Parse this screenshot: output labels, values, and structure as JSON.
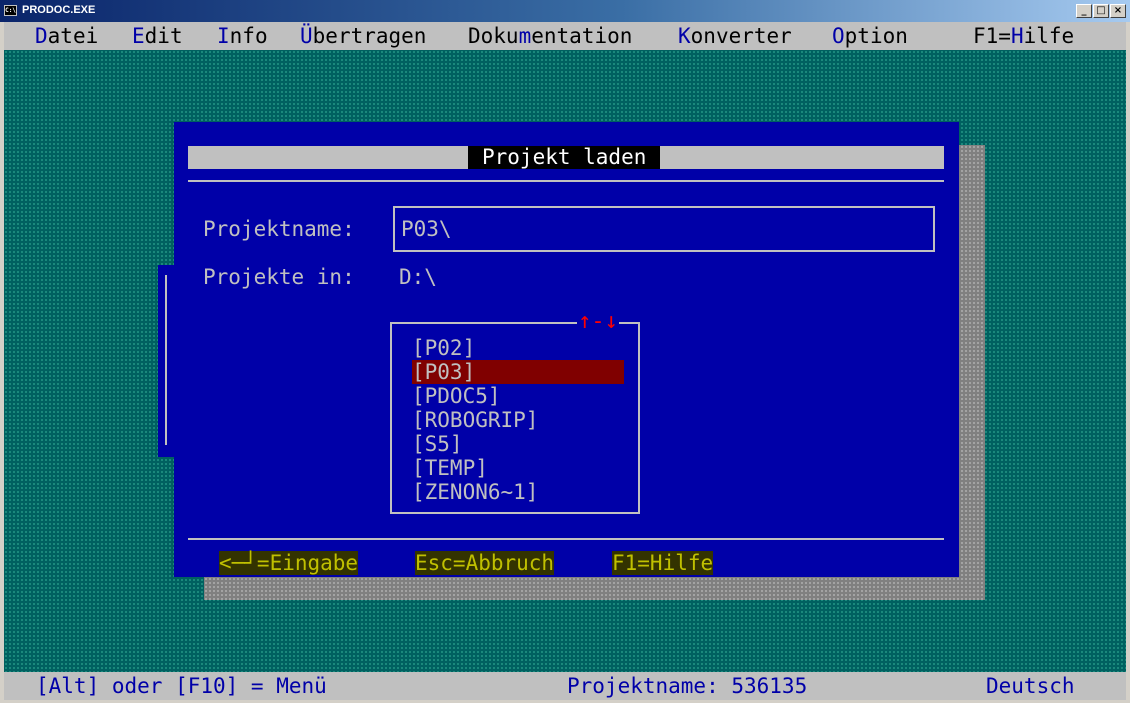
{
  "window": {
    "title": "PRODOC.EXE",
    "icon": "dos-console-icon",
    "icon_text": "C:\\",
    "minimize_glyph": "_",
    "maximize_glyph": "□",
    "close_glyph": "×"
  },
  "menubar": {
    "items": [
      {
        "pre": "",
        "hotkey": "D",
        "post": "atei"
      },
      {
        "pre": "",
        "hotkey": "E",
        "post": "dit"
      },
      {
        "pre": "",
        "hotkey": "I",
        "post": "nfo"
      },
      {
        "pre": "",
        "hotkey": "Ü",
        "post": "bertragen"
      },
      {
        "pre": "Doku",
        "hotkey": "m",
        "post": "entation"
      },
      {
        "pre": "",
        "hotkey": "K",
        "post": "onverter"
      },
      {
        "pre": "",
        "hotkey": "O",
        "post": "ption"
      },
      {
        "pre": "F1=",
        "hotkey": "H",
        "post": "ilfe"
      }
    ]
  },
  "dialog": {
    "title": "Projekt laden",
    "projektname_label": "Projektname:",
    "projektname_value": "P03\\",
    "projekte_in_label": "Projekte in:",
    "projekte_in_value": "D:\\",
    "scroll_indicator": "↑-↓",
    "list": [
      {
        "label": "[P02]",
        "selected": false
      },
      {
        "label": "[P03]",
        "selected": true
      },
      {
        "label": "[PDOC5]",
        "selected": false
      },
      {
        "label": "[ROBOGRIP]",
        "selected": false
      },
      {
        "label": "[S5]",
        "selected": false
      },
      {
        "label": "[TEMP]",
        "selected": false
      },
      {
        "label": "[ZENON6~1]",
        "selected": false
      }
    ],
    "hints": {
      "enter": "<─┘=Eingabe",
      "escape": "Esc=Abbruch",
      "help": "F1=Hilfe"
    }
  },
  "statusbar": {
    "menu_hint": "[Alt] oder [F10] = Menü",
    "project": "Projektname: 536135",
    "language": "Deutsch"
  },
  "colors": {
    "desktop": "#006060",
    "dialog_bg": "#0000a8",
    "selection": "#800000",
    "hotkey": "#0000a8",
    "scroll_arrows": "#ff0000",
    "hint_text": "#c0c000"
  }
}
